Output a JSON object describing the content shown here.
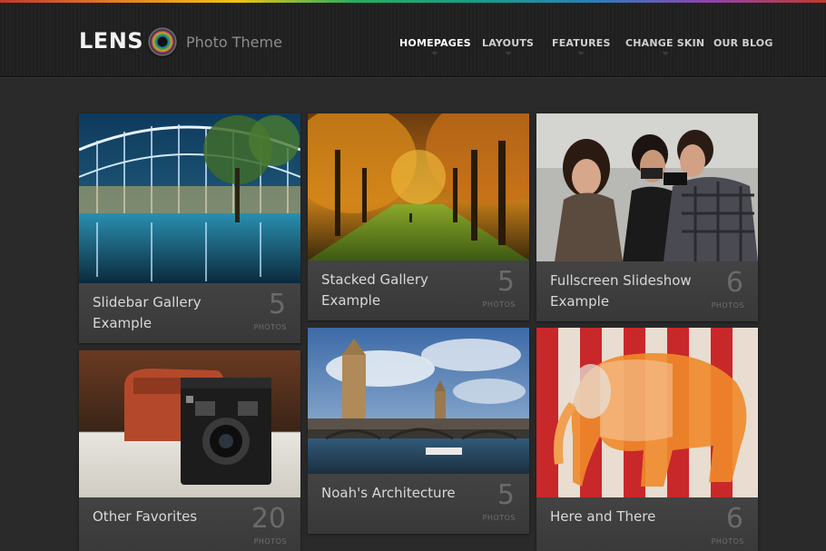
{
  "header": {
    "logo": "LENS",
    "tagline": "Photo Theme",
    "nav": [
      "HOMEPAGES",
      "LAYOUTS",
      "FEATURES",
      "CHANGE SKIN",
      "OUR BLOG"
    ]
  },
  "galleries": [
    {
      "title": "Slidebar Gallery Example",
      "count": "5",
      "unit": "PHOTOS"
    },
    {
      "title": "Stacked Gallery Example",
      "count": "5",
      "unit": "PHOTOS"
    },
    {
      "title": "Fullscreen Slideshow Example",
      "count": "6",
      "unit": "PHOTOS"
    },
    {
      "title": "Other Favorites",
      "count": "20",
      "unit": "PHOTOS"
    },
    {
      "title": "Noah's Architecture",
      "count": "5",
      "unit": "PHOTOS"
    },
    {
      "title": "Here and There",
      "count": "6",
      "unit": "PHOTOS"
    }
  ]
}
